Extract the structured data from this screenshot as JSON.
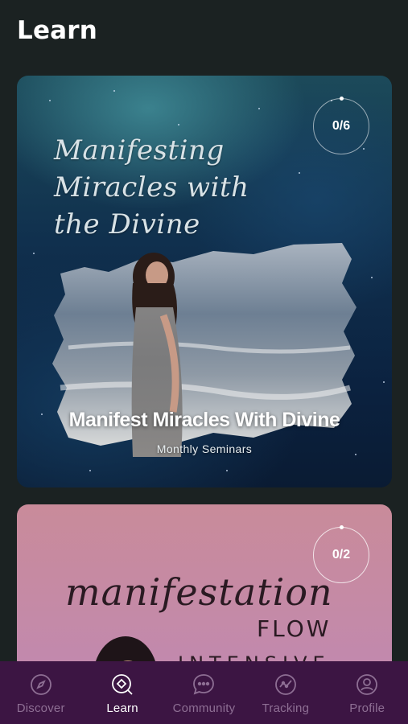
{
  "header": {
    "title": "Learn"
  },
  "courses": [
    {
      "cover_text": [
        "Manifesting",
        "Miracles with",
        "the Divine"
      ],
      "title": "Manifest Miracles With Divine",
      "subtitle": "Monthly Seminars",
      "progress": "0/6"
    },
    {
      "cover_text": [
        "manifestation",
        "FLOW",
        "INTENSIVE"
      ],
      "progress": "0/2"
    }
  ],
  "tabbar": {
    "active": "Learn",
    "tabs": [
      {
        "label": "Discover",
        "icon": "compass-icon"
      },
      {
        "label": "Learn",
        "icon": "learn-icon"
      },
      {
        "label": "Community",
        "icon": "chat-bubble-icon"
      },
      {
        "label": "Tracking",
        "icon": "tracking-chart-icon"
      },
      {
        "label": "Profile",
        "icon": "user-circle-icon"
      }
    ]
  },
  "colors": {
    "background": "#1b2222",
    "tabbar": "#3c1543",
    "tab_inactive": "#8e6f94",
    "tab_active": "#ffffff"
  }
}
